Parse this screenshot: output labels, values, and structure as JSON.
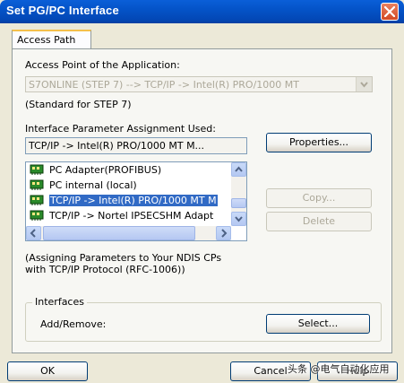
{
  "window": {
    "title": "Set PG/PC Interface"
  },
  "tabs": [
    {
      "label": "Access Path"
    }
  ],
  "access_point": {
    "label": "Access Point of the Application:",
    "value": "S7ONLINE      (STEP 7)      --> TCP/IP -> Intel(R) PRO/1000 MT",
    "note": "(Standard for STEP 7)"
  },
  "interface_param": {
    "label": "Interface Parameter Assignment Used:",
    "value": "TCP/IP -> Intel(R) PRO/1000 MT M...",
    "properties_button": "Properties..."
  },
  "param_list": {
    "items": [
      {
        "label": "PC Adapter(PROFIBUS)",
        "selected": false
      },
      {
        "label": "PC internal (local)",
        "selected": false
      },
      {
        "label": "TCP/IP -> Intel(R) PRO/1000 MT M",
        "selected": true
      },
      {
        "label": "TCP/IP -> Nortel IPSECSHM Adapt",
        "selected": false
      }
    ]
  },
  "side_buttons": {
    "copy": "Copy...",
    "delete": "Delete"
  },
  "description": {
    "line1": "(Assigning Parameters to Your NDIS CPs",
    "line2": "with TCP/IP Protocol (RFC-1006))"
  },
  "interfaces": {
    "group_title": "Interfaces",
    "add_remove_label": "Add/Remove:",
    "select_button": "Select..."
  },
  "footer": {
    "ok": "OK",
    "cancel": "Cancel",
    "help": "Help"
  },
  "watermark": {
    "text": "头条 @电气自动化应用"
  },
  "colors": {
    "titlebar": "#0453c8",
    "selection": "#316ac5",
    "face": "#ece9d8"
  }
}
